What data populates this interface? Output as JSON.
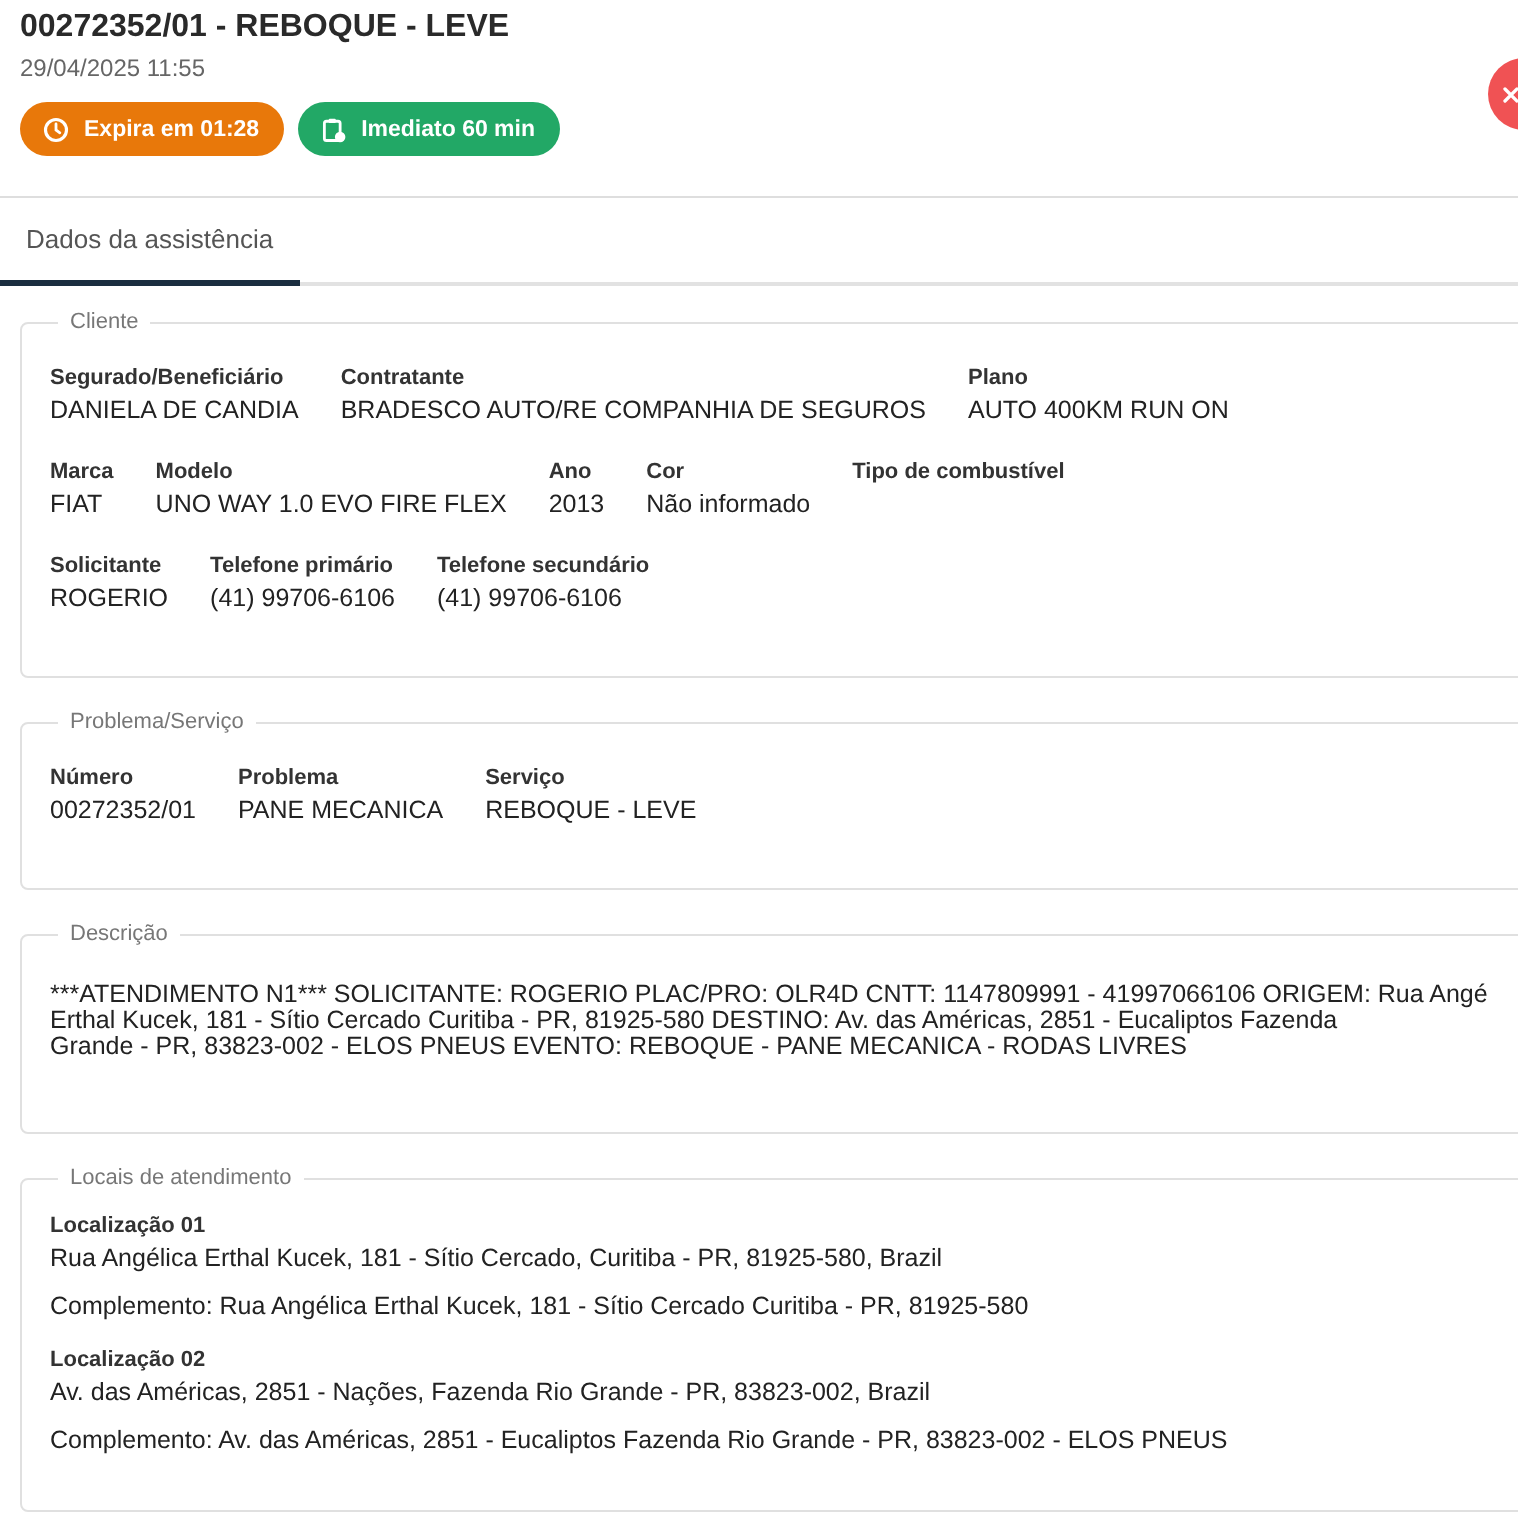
{
  "header": {
    "title": "00272352/01 - REBOQUE - LEVE",
    "datetime": "29/04/2025 11:55",
    "badges": [
      {
        "kind": "timer",
        "label": "Expira em 01:28",
        "color": "#e8780a"
      },
      {
        "kind": "schedule",
        "label": "Imediato 60 min",
        "color": "#22a866"
      }
    ]
  },
  "tabs": [
    {
      "label": "Dados da assistência",
      "selected": true
    }
  ],
  "sections": [
    {
      "kind": "fields",
      "title": "Cliente",
      "rows": [
        [
          {
            "label": "Segurado/Beneficiário",
            "value": "DANIELA DE CANDIA"
          },
          {
            "label": "Contratante",
            "value": "BRADESCO AUTO/RE COMPANHIA DE SEGUROS"
          },
          {
            "label": "Plano",
            "value": "AUTO 400KM RUN ON"
          }
        ],
        [
          {
            "label": "Marca",
            "value": "FIAT"
          },
          {
            "label": "Modelo",
            "value": "UNO WAY 1.0 EVO FIRE FLEX"
          },
          {
            "label": "Ano",
            "value": "2013"
          },
          {
            "label": "Cor",
            "value": "Não informado"
          },
          {
            "label": "Tipo de combustível"
          }
        ],
        [
          {
            "label": "Solicitante",
            "value": "ROGERIO"
          },
          {
            "label": "Telefone primário",
            "value": "(41) 99706-6106"
          },
          {
            "label": "Telefone secundário",
            "value": "(41) 99706-6106"
          }
        ]
      ]
    },
    {
      "kind": "fields",
      "title": "Problema/Serviço",
      "rows": [
        [
          {
            "label": "Número",
            "value": "00272352/01"
          },
          {
            "label": "Problema",
            "value": "PANE MECANICA"
          },
          {
            "label": "Serviço",
            "value": "REBOQUE - LEVE"
          }
        ]
      ]
    },
    {
      "kind": "text",
      "title": "Descrição",
      "lines": [
        "***ATENDIMENTO N1*** SOLICITANTE: ROGERIO PLAC/PRO: OLR4D CNTT: 1147809991 - 41997066106 ORIGEM: Rua Angé",
        "Erthal Kucek, 181 - Sítio Cercado Curitiba - PR, 81925-580 DESTINO: Av. das Américas, 2851 - Eucaliptos Fazenda",
        "Grande - PR, 83823-002 - ELOS PNEUS EVENTO: REBOQUE - PANE MECANICA - RODAS LIVRES"
      ]
    },
    {
      "kind": "locations",
      "title": "Locais de atendimento",
      "locations": [
        {
          "label": "Localização 01",
          "address": "Rua Angélica Erthal Kucek, 181 - Sítio Cercado, Curitiba - PR, 81925-580, Brazil",
          "complement": "Complemento: Rua Angélica Erthal Kucek, 181 - Sítio Cercado Curitiba - PR, 81925-580"
        },
        {
          "label": "Localização 02",
          "address": "Av. das Américas, 2851 - Nações, Fazenda Rio Grande - PR, 83823-002, Brazil",
          "complement": "Complemento: Av. das Américas, 2851 - Eucaliptos Fazenda Rio Grande - PR, 83823-002 - ELOS PNEUS"
        }
      ]
    }
  ]
}
